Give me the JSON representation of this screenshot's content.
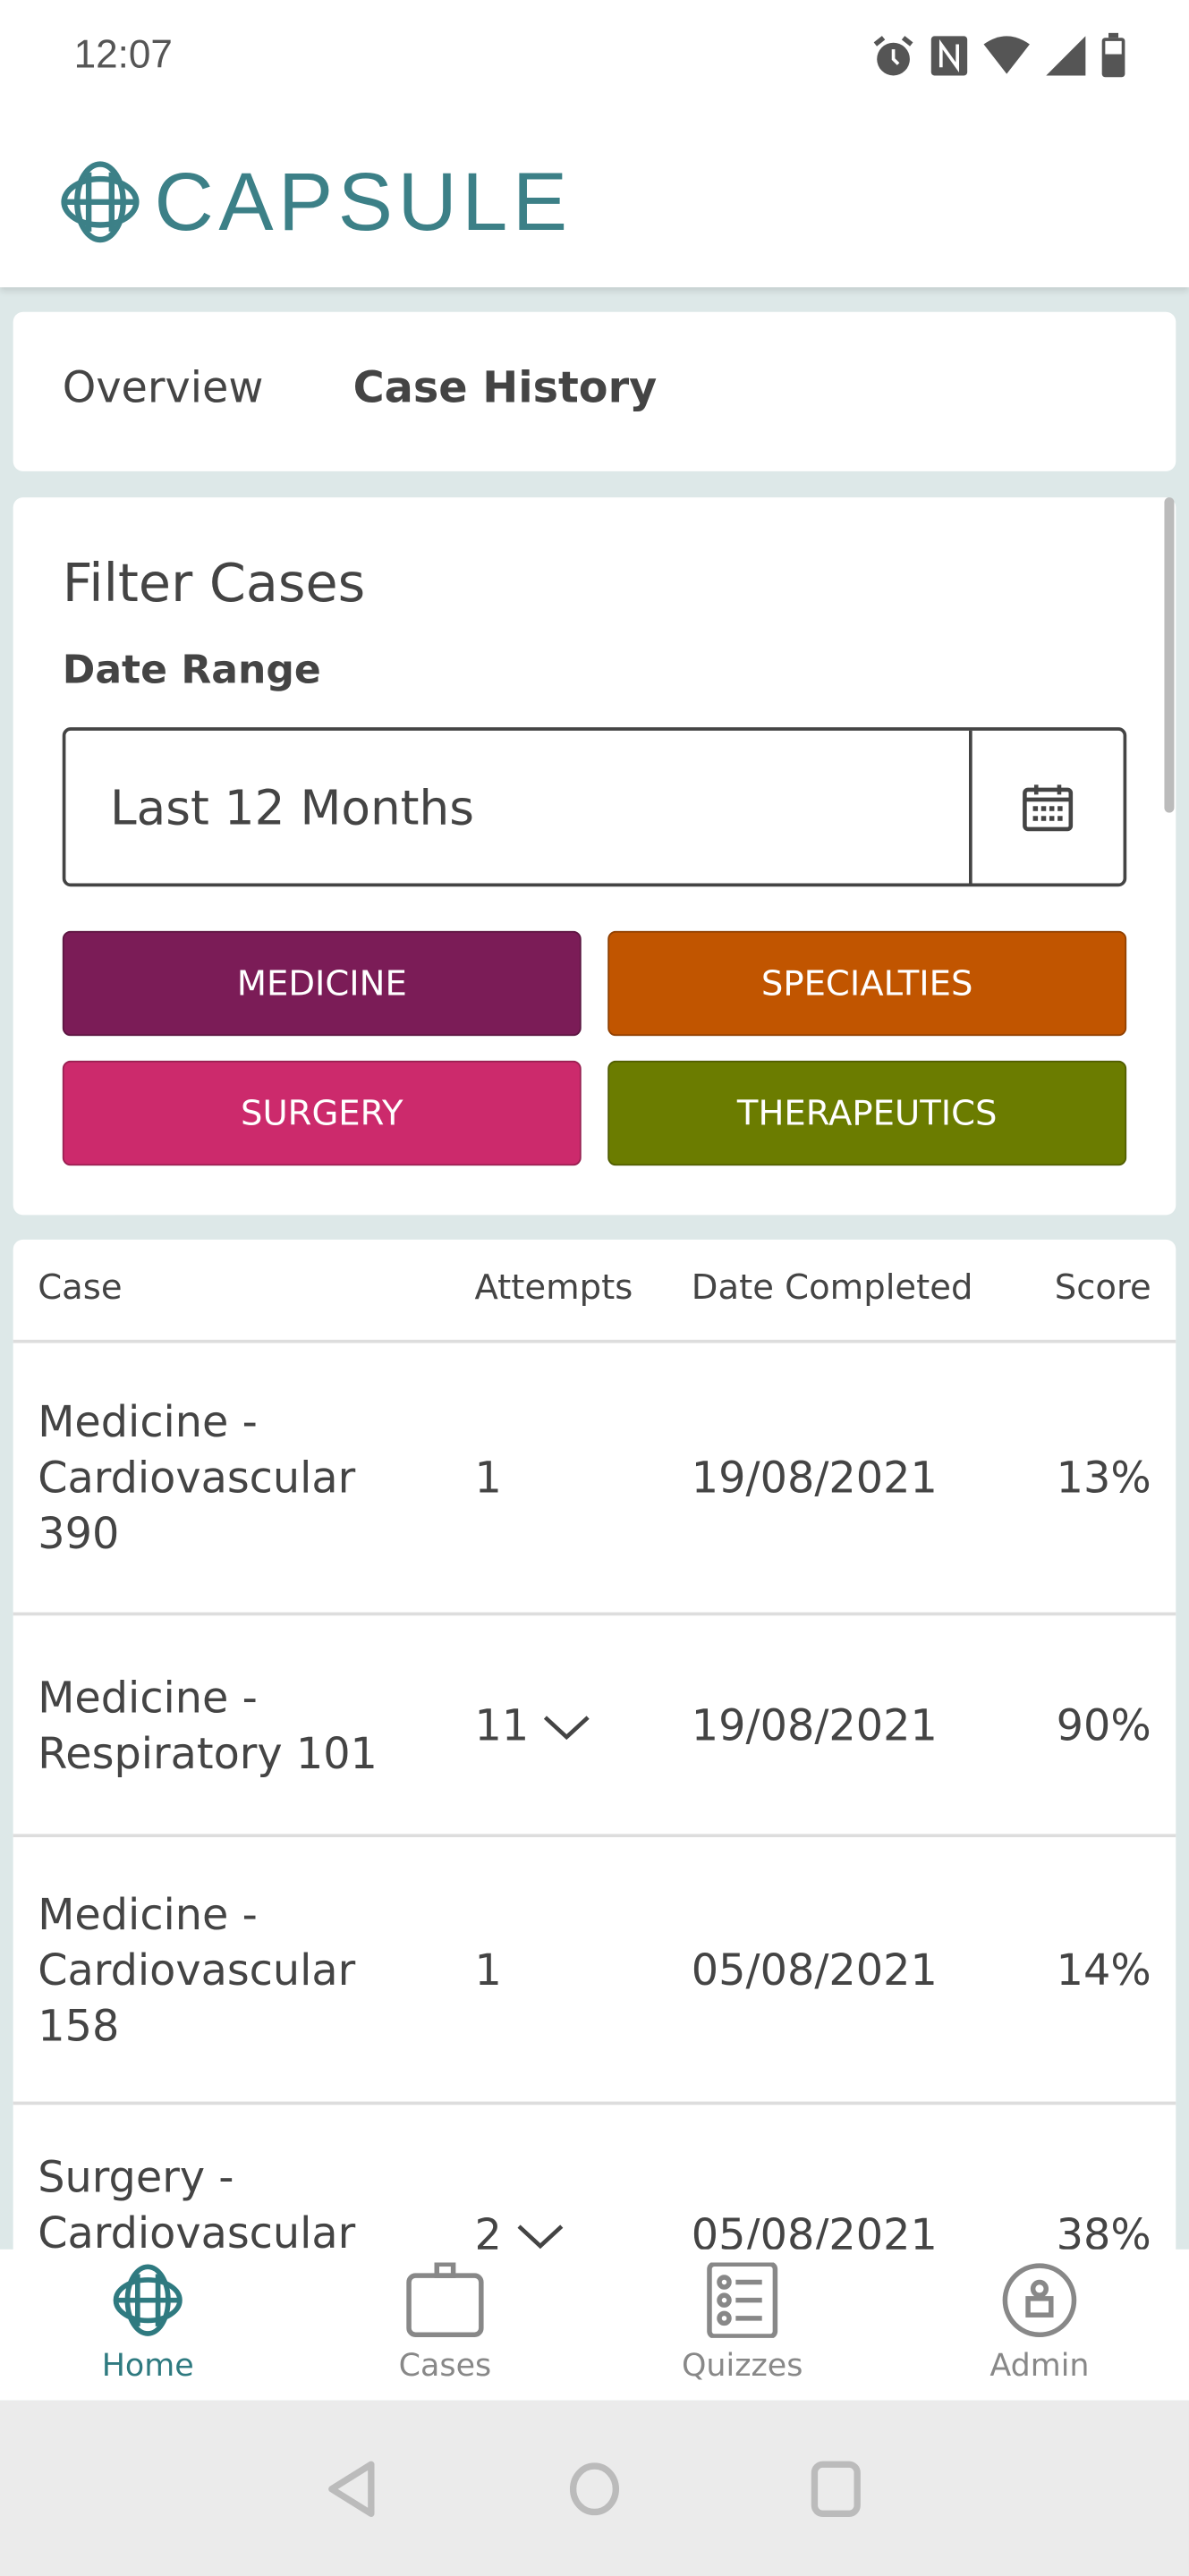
{
  "status_bar": {
    "time": "12:07",
    "icons": [
      "alarm-icon",
      "nfc-icon",
      "wifi-icon",
      "signal-icon",
      "battery-icon"
    ]
  },
  "header": {
    "brand": "CAPSULE",
    "brand_color": "#3c8087"
  },
  "tabs": [
    {
      "label": "Overview",
      "active": false
    },
    {
      "label": "Case History",
      "active": true
    }
  ],
  "filter": {
    "title": "Filter Cases",
    "date_range_label": "Date Range",
    "date_range_value": "Last 12 Months",
    "categories": [
      {
        "label": "MEDICINE",
        "color": "#7b1c57"
      },
      {
        "label": "SPECIALTIES",
        "color": "#c15500"
      },
      {
        "label": "SURGERY",
        "color": "#cc2a6c"
      },
      {
        "label": "THERAPEUTICS",
        "color": "#6b7c00"
      }
    ]
  },
  "table": {
    "headers": [
      "Case",
      "Attempts",
      "Date Completed",
      "Score"
    ],
    "rows": [
      {
        "case": "Medicine - Cardiovascular 390",
        "attempts": "1",
        "expandable": false,
        "date": "19/08/2021",
        "score": "13%"
      },
      {
        "case": "Medicine - Respiratory 101",
        "attempts": "11",
        "expandable": true,
        "date": "19/08/2021",
        "score": "90%"
      },
      {
        "case": "Medicine - Cardiovascular 158",
        "attempts": "1",
        "expandable": false,
        "date": "05/08/2021",
        "score": "14%"
      },
      {
        "case": "Surgery - Cardiovascular",
        "attempts": "2",
        "expandable": true,
        "date": "05/08/2021",
        "score": "38%"
      }
    ]
  },
  "bottom_nav": [
    {
      "label": "Home",
      "icon": "capsule-icon",
      "active": true
    },
    {
      "label": "Cases",
      "icon": "briefcase-icon"
    },
    {
      "label": "Quizzes",
      "icon": "list-icon"
    },
    {
      "label": "Admin",
      "icon": "user-icon"
    }
  ],
  "active_color": "#2f7a80"
}
